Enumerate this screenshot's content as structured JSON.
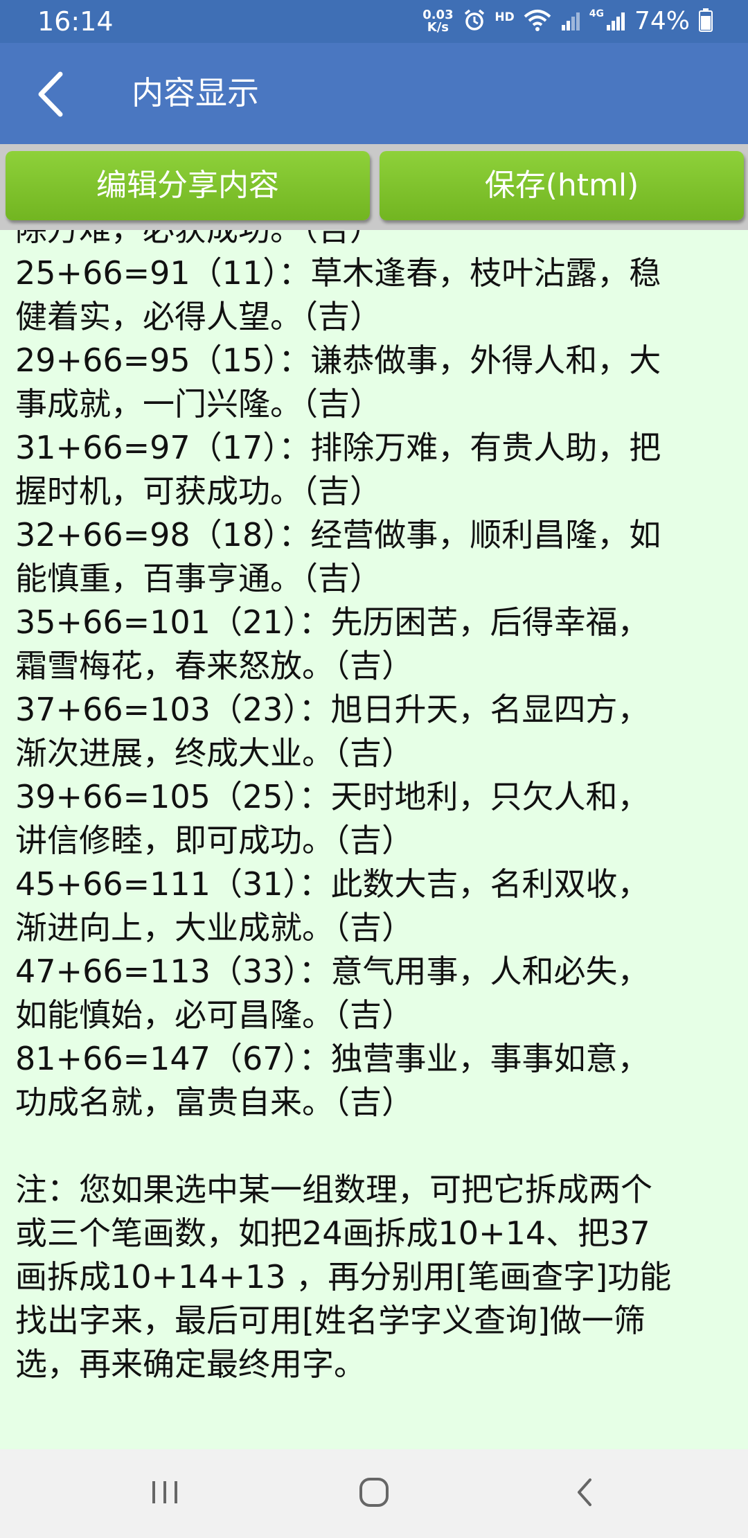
{
  "status_bar": {
    "time": "16:14",
    "net_speed_value": "0.03",
    "net_speed_unit": "K/s",
    "hd_label": "HD",
    "network_label": "4G",
    "battery_percent": "74%"
  },
  "app_bar": {
    "title": "内容显示"
  },
  "toolbar": {
    "edit_share_label": "编辑分享内容",
    "save_html_label": "保存(html)"
  },
  "content": {
    "lines": [
      "除万难，必获成功。（吉）",
      "25+66=91（11）：草木逢春，枝叶沾露，稳",
      "健着实，必得人望。（吉）",
      "29+66=95（15）：谦恭做事，外得人和，大",
      "事成就，一门兴隆。（吉）",
      "31+66=97（17）：排除万难，有贵人助，把",
      "握时机，可获成功。（吉）",
      "32+66=98（18）：经营做事，顺利昌隆，如",
      "能慎重，百事亨通。（吉）",
      "35+66=101（21）：先历困苦，后得幸福，",
      "霜雪梅花，春来怒放。（吉）",
      "37+66=103（23）：旭日升天，名显四方，",
      "渐次进展，终成大业。（吉）",
      "39+66=105（25）：天时地利，只欠人和，",
      "讲信修睦，即可成功。（吉）",
      "45+66=111（31）：此数大吉，名利双收，",
      "渐进向上，大业成就。（吉）",
      "47+66=113（33）：意气用事，人和必失，",
      "如能慎始，必可昌隆。（吉）",
      "81+66=147（67）：独营事业，事事如意，",
      "功成名就，富贵自来。（吉）",
      "",
      "注：您如果选中某一组数理，可把它拆成两个",
      "或三个笔画数，如把24画拆成10+14、把37",
      "画拆成10+14+13 ，再分别用[笔画查字]功能",
      "找出字来，最后可用[姓名学字义查询]做一筛",
      "选，再来确定最终用字。"
    ]
  },
  "icons": {
    "back": "chevron-left-icon",
    "alarm": "alarm-icon",
    "wifi": "wifi-icon",
    "signal": "signal-icon",
    "battery": "battery-icon",
    "nav_recent": "recent-apps-icon",
    "nav_home": "home-icon",
    "nav_back": "back-icon"
  },
  "colors": {
    "status_bar": "#3f6fb5",
    "app_bar": "#4a77c1",
    "button_green": "#7cc22a",
    "content_bg": "#e6ffe6",
    "nav_bar": "#f1f1f1"
  }
}
